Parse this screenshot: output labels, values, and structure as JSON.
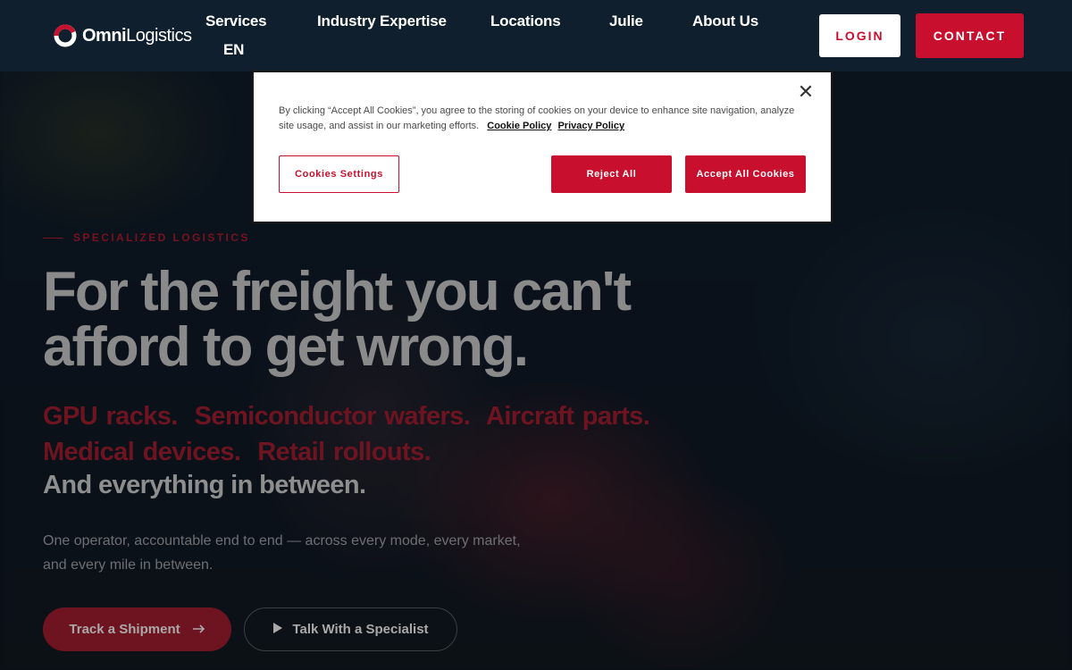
{
  "header": {
    "logo": {
      "bold": "Omni",
      "light": "Logistics",
      "mark": "omni-ring-logo"
    },
    "nav": [
      {
        "label": "Services"
      },
      {
        "label": "Industry Expertise"
      },
      {
        "label": "Locations"
      },
      {
        "label": "Julie"
      },
      {
        "label": "About Us"
      },
      {
        "label": "EN"
      }
    ],
    "login_label": "LOGIN",
    "contact_label": "CONTACT"
  },
  "hero": {
    "eyebrow": "SPECIALIZED LOGISTICS",
    "headline": "For the freight you can't afford to get wrong.",
    "sub_red_line1": "GPU racks.  Semiconductor wafers.  Aircraft parts.",
    "sub_red_line2": "Medical devices.  Retail rollouts.",
    "sub_gray": "And everything in between.",
    "description": "One operator, accountable end to end — across every mode, every market, and every mile in between.",
    "track_button": {
      "label": "Track a Shipment",
      "icon": "arrow-right-icon"
    },
    "talk_button": {
      "label": "Talk With a Specialist",
      "icon": "play-icon"
    }
  },
  "cookie_banner": {
    "text": "By clicking “Accept All Cookies”, you agree to the storing of cookies on your device to enhance site navigation, analyze site usage, and assist in our marketing efforts.",
    "cookie_policy_link": "Cookie Policy",
    "privacy_policy_link": "Privacy Policy",
    "settings_label": "Cookies Settings",
    "reject_label": "Reject All",
    "accept_label": "Accept All Cookies",
    "close_icon": "close-icon"
  },
  "colors": {
    "brand_red": "#c8102e",
    "header_bg": "#0f1f2e"
  }
}
